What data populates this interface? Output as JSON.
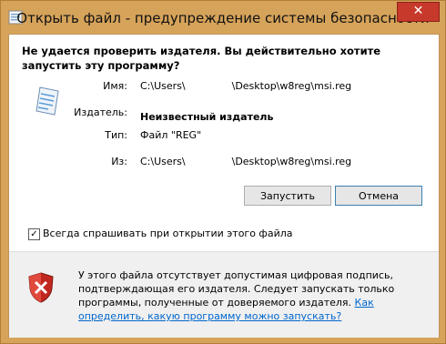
{
  "window": {
    "title": "Открыть файл - предупреждение системы безопасности",
    "close_label": "✕"
  },
  "header": {
    "text": "Не удается проверить издателя.  Вы действительно хотите запустить эту программу?"
  },
  "details": {
    "name_label": "Имя:",
    "name_value_start": "C:\\Users\\",
    "name_value_end": "\\Desktop\\w8reg\\msi.reg",
    "publisher_label": "Издатель:",
    "publisher_value": "Неизвестный издатель",
    "type_label": "Тип:",
    "type_value": "Файл \"REG\"",
    "from_label": "Из:",
    "from_value_start": "C:\\Users\\",
    "from_value_end": "\\Desktop\\w8reg\\msi.reg"
  },
  "buttons": {
    "run": "Запустить",
    "cancel": "Отмена"
  },
  "checkbox": {
    "checked": true,
    "label": "Всегда спрашивать при открытии этого файла"
  },
  "warning": {
    "text": "У этого файла отсутствует допустимая цифровая подпись, подтверждающая его издателя. Следует запускать только программы, полученные от доверяемого издателя.",
    "link": "Как определить, какую программу можно запускать?"
  }
}
